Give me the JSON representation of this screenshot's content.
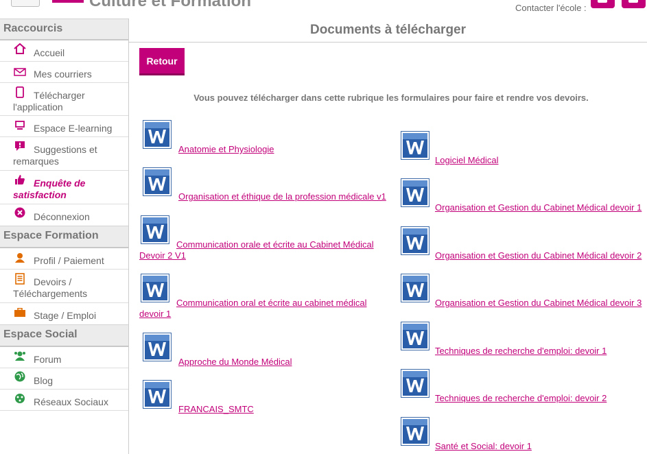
{
  "header": {
    "brand": "Culture et Formation",
    "contact_label": "Contacter l'école :",
    "accent_color": "#c2007a"
  },
  "sidebar": {
    "sections": [
      {
        "title": "Raccourcis",
        "items": [
          {
            "icon": "home-icon",
            "label": "Accueil"
          },
          {
            "icon": "mail-icon",
            "label": "Mes courriers"
          },
          {
            "icon": "phone-icon",
            "label": "Télécharger l'application"
          },
          {
            "icon": "monitor-icon",
            "label": "Espace E-learning"
          },
          {
            "icon": "comment-alert-icon",
            "label": "Suggestions et remarques"
          },
          {
            "icon": "thumbs-up-icon",
            "label": "Enquête de satisfaction"
          },
          {
            "icon": "close-circle-icon",
            "label": "Déconnexion"
          }
        ]
      },
      {
        "title": "Espace Formation",
        "items": [
          {
            "icon": "user-icon",
            "label": "Profil / Paiement"
          },
          {
            "icon": "document-list-icon",
            "label": "Devoirs / Téléchargements"
          },
          {
            "icon": "briefcase-icon",
            "label": "Stage / Emploi"
          }
        ]
      },
      {
        "title": "Espace Social",
        "items": [
          {
            "icon": "users-icon",
            "label": "Forum"
          },
          {
            "icon": "globe-icon",
            "label": "Blog"
          },
          {
            "icon": "network-icon",
            "label": "Réseaux Sociaux"
          }
        ]
      }
    ]
  },
  "main": {
    "title": "Documents à télécharger",
    "back_label": "Retour",
    "intro": "Vous pouvez télécharger dans cette rubrique les formulaires pour faire et rendre vos devoirs.",
    "left_docs": [
      {
        "label": "Anatomie et Physiologie",
        "line2": ""
      },
      {
        "label": "Organisation et éthique de la profession médicale v1",
        "line2": ""
      },
      {
        "label": "Communication orale et écrite au Cabinet Médical",
        "line2": "Devoir 2 V1"
      },
      {
        "label": "Communication oral et écrite au cabinet médical",
        "line2": "devoir 1"
      },
      {
        "label": "Approche du Monde Médical",
        "line2": ""
      },
      {
        "label": "FRANCAIS_SMTC",
        "line2": ""
      }
    ],
    "right_docs": [
      {
        "label": "Logiciel Médical",
        "line2": ""
      },
      {
        "label": "Organisation et Gestion du Cabinet Médical devoir 1",
        "line2": ""
      },
      {
        "label": "Organisation et Gestion du Cabinet Médical devoir 2",
        "line2": ""
      },
      {
        "label": "Organisation et Gestion du Cabinet Médical devoir 3",
        "line2": ""
      },
      {
        "label": "Techniques de recherche d'emploi: devoir 1",
        "line2": ""
      },
      {
        "label": "Techniques de recherche d'emploi: devoir 2",
        "line2": ""
      },
      {
        "label": "Santé et Social: devoir 1",
        "line2": ""
      }
    ]
  }
}
